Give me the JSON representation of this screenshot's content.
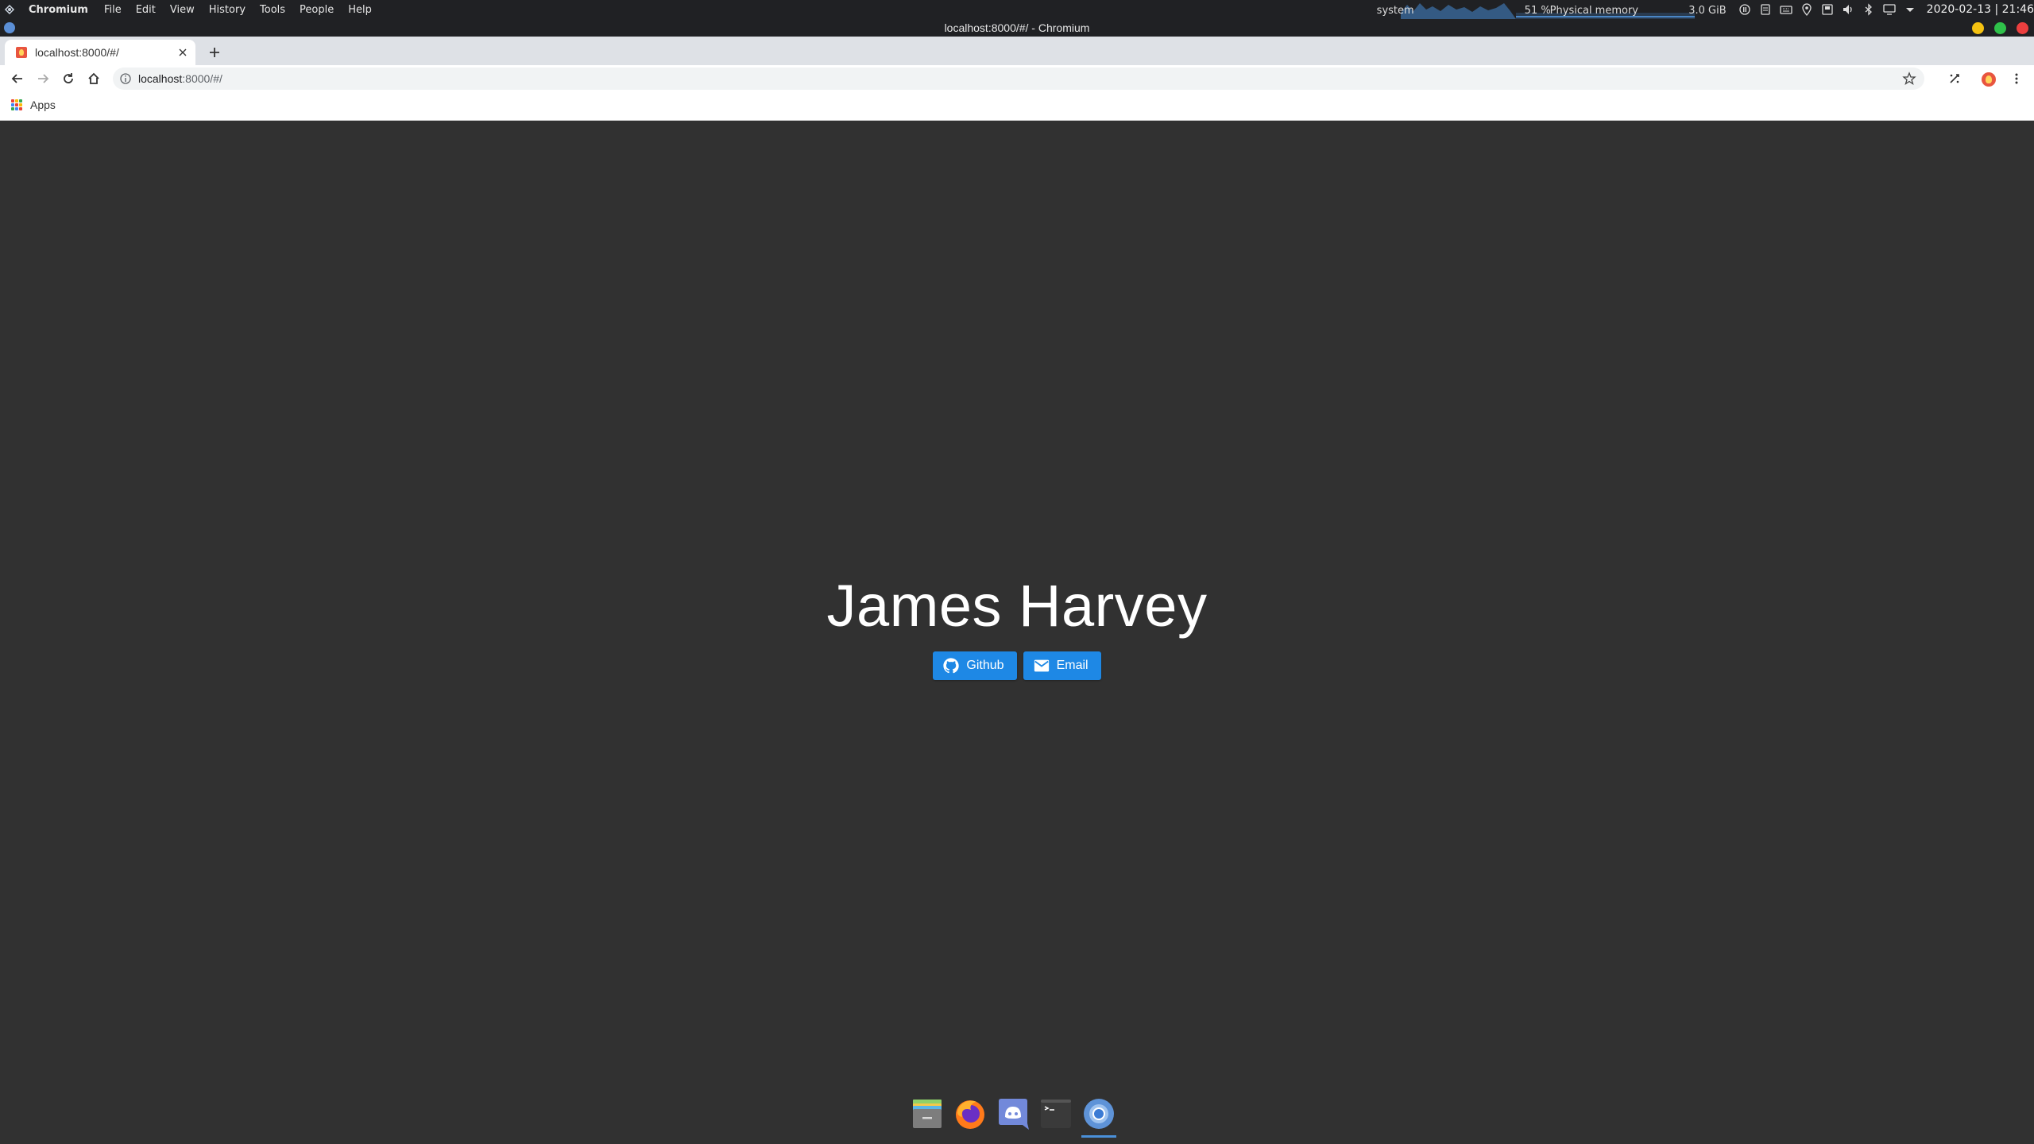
{
  "top_panel": {
    "app_name": "Chromium",
    "menu": [
      "File",
      "Edit",
      "View",
      "History",
      "Tools",
      "People",
      "Help"
    ],
    "system_monitor": {
      "label": "system",
      "percent": "51 %",
      "metric": "Physical memory",
      "memory": "3.0 GiB"
    },
    "clock": "2020-02-13 | 21:46"
  },
  "window": {
    "title": "localhost:8000/#/ - Chromium"
  },
  "tabs": [
    {
      "title": "localhost:8000/#/"
    }
  ],
  "omnibox": {
    "host": "localhost",
    "path": ":8000/#/"
  },
  "bookmarks": {
    "apps_label": "Apps"
  },
  "page": {
    "name": "James Harvey",
    "buttons": {
      "github": "Github",
      "email": "Email"
    }
  },
  "colors": {
    "page_background": "#313131",
    "button_blue": "#1e88e5",
    "panel_background": "#202124"
  },
  "dock": {
    "items": [
      "files-icon",
      "firefox-icon",
      "discord-icon",
      "terminal-icon",
      "chromium-icon"
    ]
  }
}
